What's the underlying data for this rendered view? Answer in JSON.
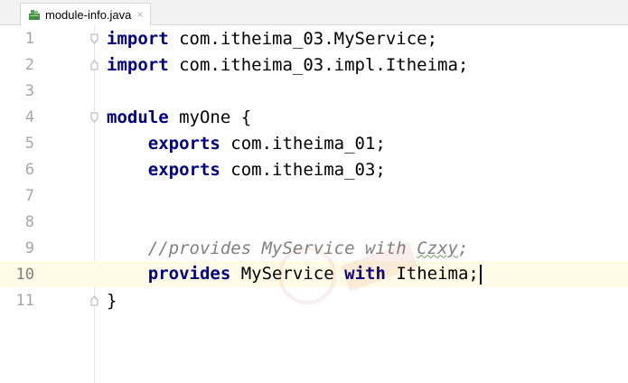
{
  "tab": {
    "label": "module-info.java",
    "close": "×",
    "icon": "java-module-file-icon"
  },
  "lines": [
    {
      "num": "1",
      "parts": [
        {
          "t": "import",
          "c": "kw"
        },
        {
          "t": " com.itheima_03.MyService;",
          "c": ""
        }
      ]
    },
    {
      "num": "2",
      "parts": [
        {
          "t": "import",
          "c": "kw"
        },
        {
          "t": " com.itheima_03.impl.Itheima;",
          "c": ""
        }
      ]
    },
    {
      "num": "3",
      "parts": []
    },
    {
      "num": "4",
      "parts": [
        {
          "t": "module",
          "c": "kw"
        },
        {
          "t": " myOne {",
          "c": ""
        }
      ]
    },
    {
      "num": "5",
      "parts": [
        {
          "t": "    ",
          "c": ""
        },
        {
          "t": "exports",
          "c": "kw"
        },
        {
          "t": " com.itheima_01;",
          "c": ""
        }
      ]
    },
    {
      "num": "6",
      "parts": [
        {
          "t": "    ",
          "c": ""
        },
        {
          "t": "exports",
          "c": "kw"
        },
        {
          "t": " com.itheima_03;",
          "c": ""
        }
      ]
    },
    {
      "num": "7",
      "parts": []
    },
    {
      "num": "8",
      "parts": []
    },
    {
      "num": "9",
      "parts": [
        {
          "t": "    ",
          "c": ""
        },
        {
          "t": "//provides MyService with ",
          "c": "cm"
        },
        {
          "t": "Czxy",
          "c": "cm squig"
        },
        {
          "t": ";",
          "c": "cm"
        }
      ]
    },
    {
      "num": "10",
      "parts": [
        {
          "t": "    ",
          "c": ""
        },
        {
          "t": "provides",
          "c": "kw"
        },
        {
          "t": " MyService ",
          "c": ""
        },
        {
          "t": "with",
          "c": "kw"
        },
        {
          "t": " Itheima;",
          "c": ""
        }
      ],
      "current": true
    },
    {
      "num": "11",
      "parts": [
        {
          "t": "}",
          "c": ""
        }
      ]
    }
  ],
  "colors": {
    "keyword": "#000080",
    "comment": "#808080",
    "current_line": "#fffbe6"
  }
}
